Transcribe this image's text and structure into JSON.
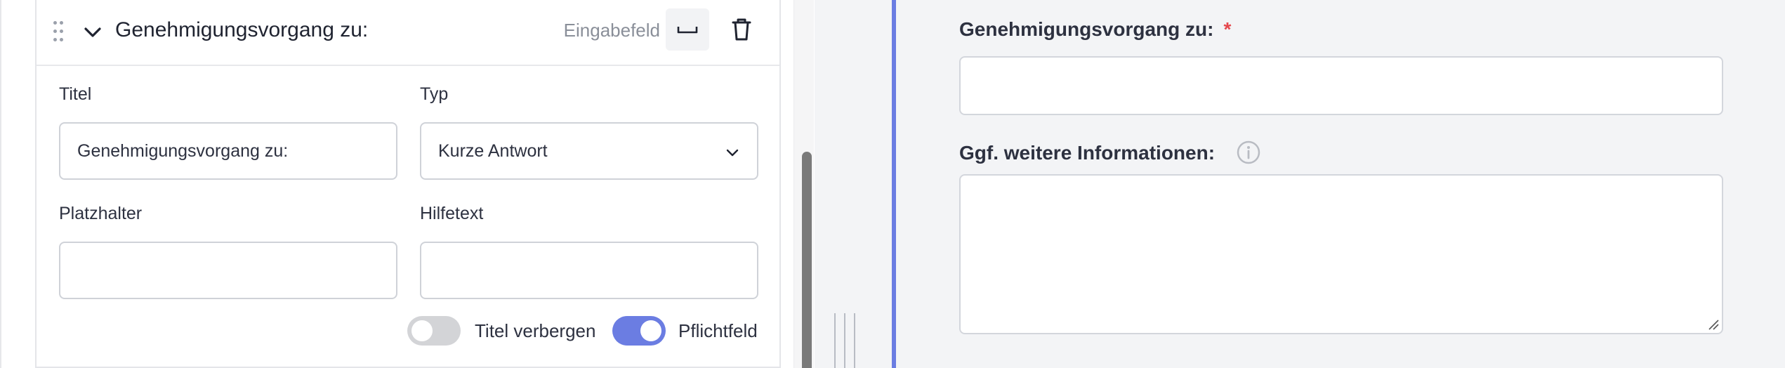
{
  "editor": {
    "field_title": "Genehmigungsvorgang zu:",
    "field_type_label": "Eingabefeld",
    "icons": {
      "drag": "drag-handle-icon",
      "collapse": "chevron-down-icon",
      "layout": "layout-width-icon",
      "delete": "trash-icon"
    },
    "form": {
      "title_label": "Titel",
      "title_value": "Genehmigungsvorgang zu:",
      "type_label": "Typ",
      "type_value": "Kurze Antwort",
      "placeholder_label": "Platzhalter",
      "placeholder_value": "",
      "helptext_label": "Hilfetext",
      "helptext_value": ""
    },
    "toggles": {
      "hide_title_label": "Titel verbergen",
      "hide_title_on": false,
      "required_label": "Pflichtfeld",
      "required_on": true
    }
  },
  "preview": {
    "field1_label": "Genehmigungsvorgang zu:",
    "field1_required_mark": "*",
    "field1_value": "",
    "field2_label": "Ggf. weitere Informationen:",
    "field2_value": ""
  },
  "colors": {
    "accent": "#6b7de2",
    "required": "#e5484d",
    "border": "#cfd2d8",
    "preview_bg": "#f3f4f6"
  }
}
